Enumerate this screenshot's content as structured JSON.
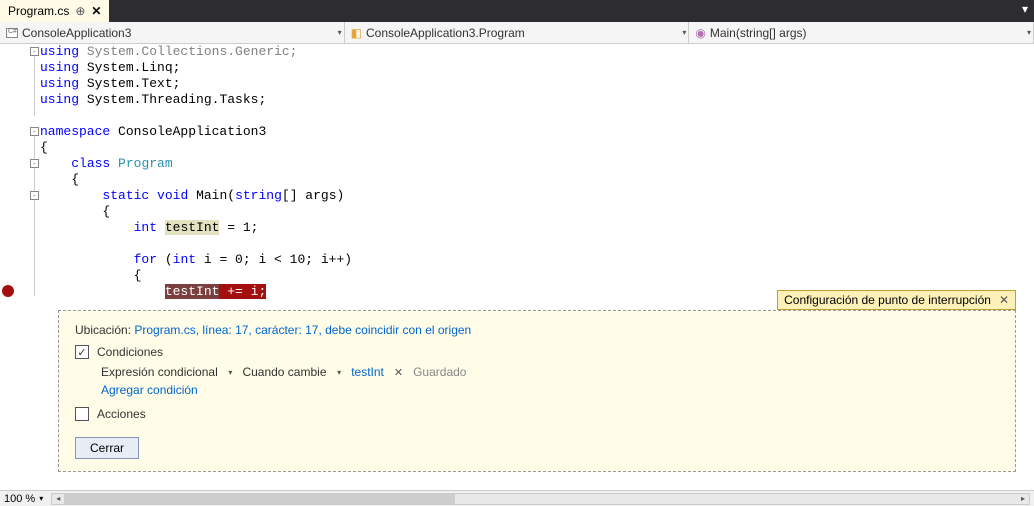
{
  "tab": {
    "filename": "Program.cs",
    "pin": "⊕",
    "close": "✕"
  },
  "nav": {
    "scope1": "ConsoleApplication3",
    "scope2": "ConsoleApplication3.Program",
    "scope3": "Main(string[] args)"
  },
  "code": {
    "l1a": "using",
    "l1b": " System.Collections.Generic;",
    "l2a": "using",
    "l2b": " System.Linq;",
    "l3a": "using",
    "l3b": " System.Text;",
    "l4a": "using",
    "l4b": " System.Threading.Tasks;",
    "l6a": "namespace",
    "l6b": " ConsoleApplication3",
    "l7": "{",
    "l8a": "    ",
    "l8b": "class",
    "l8c": " ",
    "l8d": "Program",
    "l9": "    {",
    "l10a": "        ",
    "l10b": "static",
    "l10c": " ",
    "l10d": "void",
    "l10e": " Main(",
    "l10f": "string",
    "l10g": "[] args)",
    "l11": "        {",
    "l12a": "            ",
    "l12b": "int",
    "l12c": " ",
    "l12d": "testInt",
    "l12e": " = 1;",
    "l14a": "            ",
    "l14b": "for",
    "l14c": " (",
    "l14d": "int",
    "l14e": " i = 0; i < 10; i++)",
    "l15": "            {",
    "l16a": "                ",
    "l16b": "testInt",
    "l16c": " += i;"
  },
  "bppanel": {
    "title": "Configuración de punto de interrupción",
    "close": "✕",
    "loc_label": "Ubicación:",
    "loc_link": "Program.cs, línea: 17, carácter: 17, debe coincidir con el origen",
    "cond_label": "Condiciones",
    "expr_label": "Expresión condicional",
    "when_label": "Cuando cambie",
    "param": "testInt",
    "saved": "Guardado",
    "add_cond": "Agregar condición",
    "actions_label": "Acciones",
    "close_btn": "Cerrar"
  },
  "zoom": {
    "value": "100 %"
  }
}
